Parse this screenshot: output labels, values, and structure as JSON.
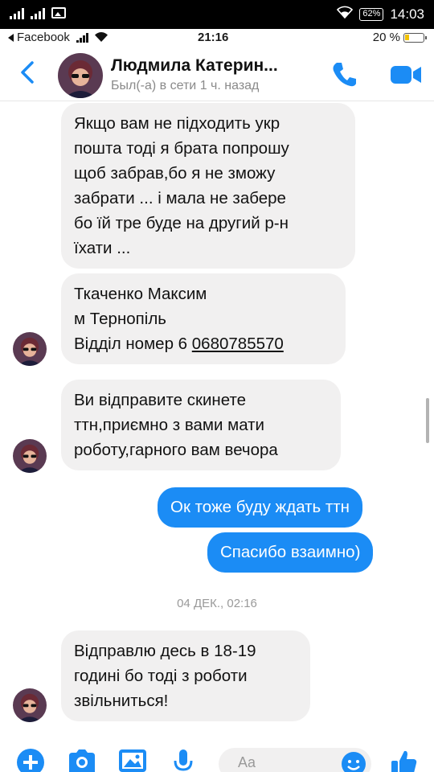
{
  "outer_status": {
    "time": "14:03",
    "battery": "62%"
  },
  "inner_status": {
    "back_app": "Facebook",
    "time": "21:16",
    "battery": "20 %"
  },
  "header": {
    "name": "Людмила Катерин...",
    "status": "Был(-а) в сети 1 ч. назад"
  },
  "messages": [
    {
      "dir": "in",
      "text": "Якщо вам не підходить  укр\nпошта тоді я брата попрошу\nщоб забрав,бо я не зможу\nзабрати ... і мала не забере\nбо їй тре буде на другий р-н\nїхати ..."
    },
    {
      "dir": "in",
      "line1": "Ткаченко Максим",
      "line2": "м Тернопіль",
      "line3_prefix": "Відділ номер 6 ",
      "phone": "0680785570"
    },
    {
      "dir": "in",
      "text": "Ви відправите скинете\nттн,приємно з вами мати\nроботу,гарного вам вечора"
    },
    {
      "dir": "out",
      "text": "Ок тоже буду ждать ттн"
    },
    {
      "dir": "out",
      "text": "Спасибо взаимно)"
    },
    {
      "dir": "in",
      "text": "Відправлю десь в 18-19\nгодині бо тоді з роботи\nзвільниться!"
    }
  ],
  "date_separator": "04 ДЕК., 02:16",
  "composer": {
    "placeholder": "Aa"
  },
  "icons": {
    "back": "chevron-left-icon",
    "call": "phone-icon",
    "video": "video-camera-icon",
    "plus": "plus-icon",
    "camera": "camera-icon",
    "gallery": "image-icon",
    "mic": "microphone-icon",
    "emoji": "emoji-icon",
    "like": "thumbs-up-icon"
  },
  "colors": {
    "accent": "#1b8cf5",
    "incoming_bubble": "#f1f0f0",
    "muted_text": "#8a8a8a"
  }
}
